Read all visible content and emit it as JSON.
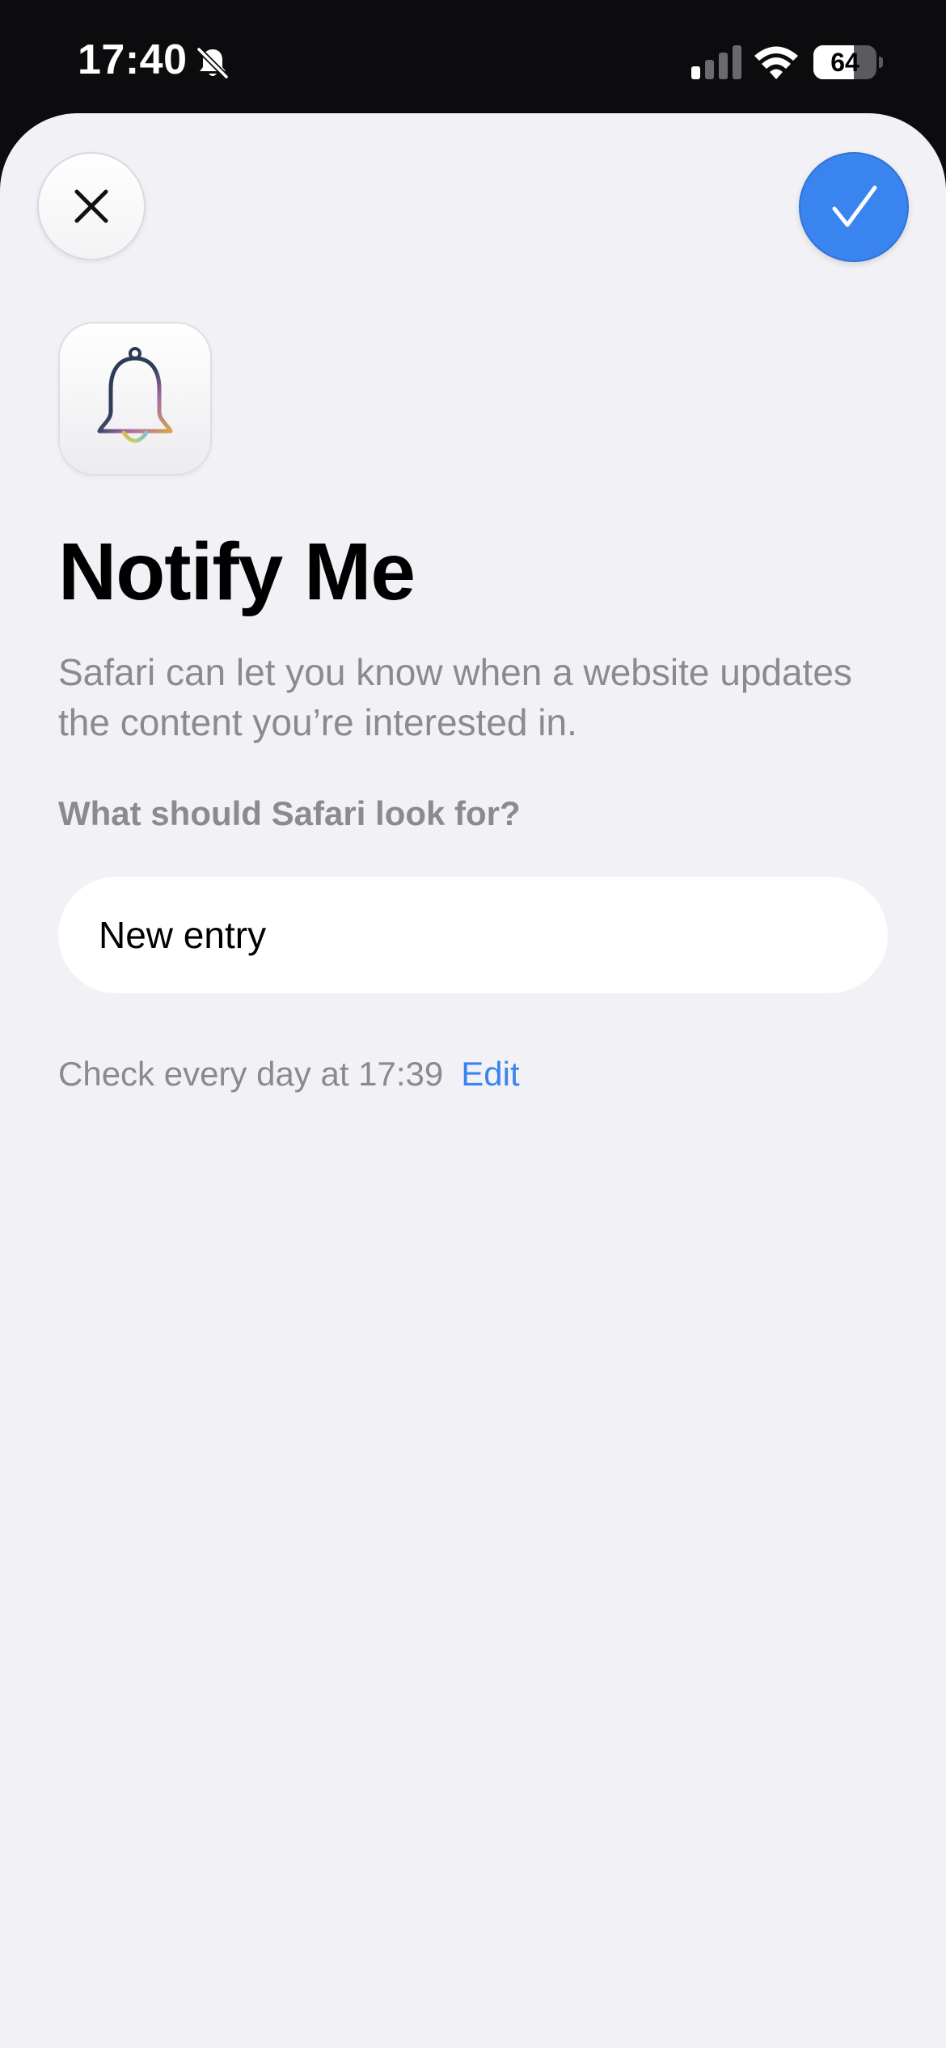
{
  "status_bar": {
    "time": "17:40",
    "battery_level": "64",
    "battery_fraction": 0.64,
    "icons": [
      "bell-slash-icon",
      "cellular-signal-icon",
      "wifi-icon",
      "battery-icon"
    ]
  },
  "sheet": {
    "close_icon": "xmark-icon",
    "confirm_icon": "checkmark-icon",
    "app_icon": "bell-icon",
    "title": "Notify Me",
    "description": "Safari can let you know when a website updates the content you’re interested in.",
    "question": "What should Safari look for?",
    "entry_value": "New entry",
    "schedule_text": "Check every day at 17:39",
    "edit_label": "Edit"
  },
  "colors": {
    "accent": "#3a84f0",
    "sheet_background": "#f1f1f6",
    "secondary_text": "#8a8a8f"
  }
}
